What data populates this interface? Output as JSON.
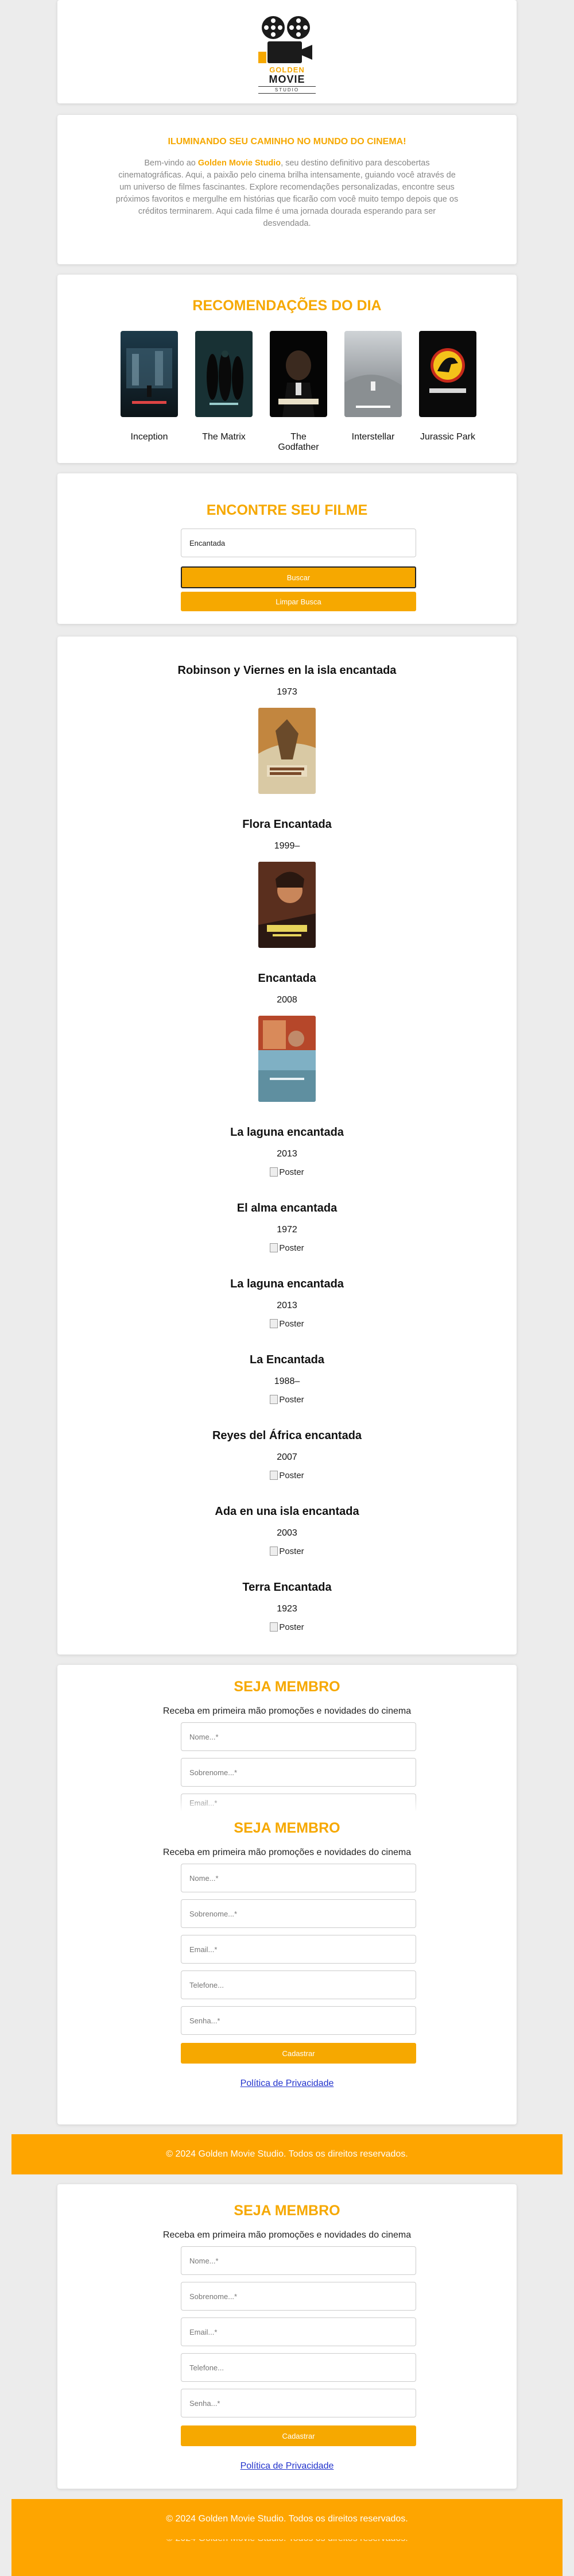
{
  "logo": {
    "line1": "GOLDEN",
    "line2": "MOVIE",
    "line3": "STUDIO"
  },
  "intro": {
    "heading": "ILUMINANDO SEU CAMINHO NO MUNDO DO CINEMA!",
    "text_before": "Bem-vindo ao ",
    "brand": "Golden Movie Studio",
    "text_after": ", seu destino definitivo para descobertas cinematográficas. Aqui, a paixão pelo cinema brilha intensamente, guiando você através de um universo de filmes fascinantes. Explore recomendações personalizadas, encontre seus próximos favoritos e mergulhe em histórias que ficarão com você muito tempo depois que os créditos terminarem. Aqui cada filme é uma jornada dourada esperando para ser desvendada."
  },
  "recommendations": {
    "heading": "RECOMENDAÇÕES DO DIA",
    "items": [
      {
        "title": "Inception"
      },
      {
        "title": "The Matrix"
      },
      {
        "title": "The Godfather"
      },
      {
        "title": "Interstellar"
      },
      {
        "title": "Jurassic Park"
      }
    ]
  },
  "search": {
    "heading": "ENCONTRE SEU FILME",
    "query": "Encantada",
    "search_button": "Buscar",
    "clear_button": "Limpar Busca"
  },
  "results": [
    {
      "title": "Robinson y Viernes en la isla encantada",
      "year": "1973",
      "poster": "image"
    },
    {
      "title": "Flora Encantada",
      "year": "1999–",
      "poster": "image"
    },
    {
      "title": "Encantada",
      "year": "2008",
      "poster": "image"
    },
    {
      "title": "La laguna encantada",
      "year": "2013",
      "poster": "broken"
    },
    {
      "title": "El alma encantada",
      "year": "1972",
      "poster": "broken"
    },
    {
      "title": "La laguna encantada",
      "year": "2013",
      "poster": "broken"
    },
    {
      "title": "La Encantada",
      "year": "1988–",
      "poster": "broken"
    },
    {
      "title": "Reyes del África encantada",
      "year": "2007",
      "poster": "broken"
    },
    {
      "title": "Ada en una isla encantada",
      "year": "2003",
      "poster": "broken"
    },
    {
      "title": "Terra Encantada",
      "year": "1923",
      "poster": "broken"
    }
  ],
  "broken_poster_alt": "Poster",
  "membership": {
    "heading": "SEJA MEMBRO",
    "subtitle": "Receba em primeira mão promoções e novidades do cinema",
    "name_placeholder": "Nome...*",
    "surname_placeholder": "Sobrenome...*",
    "email_placeholder": "Email...*",
    "phone_placeholder": "Telefone...",
    "password_placeholder": "Senha...*",
    "submit_label": "Cadastrar",
    "privacy_link": "Política de Privacidade"
  },
  "footer": {
    "text": "© 2024 Golden Movie Studio. Todos os direitos reservados."
  },
  "colors": {
    "accent": "#f6a800",
    "footer": "#fea500",
    "link": "#2233cc"
  }
}
